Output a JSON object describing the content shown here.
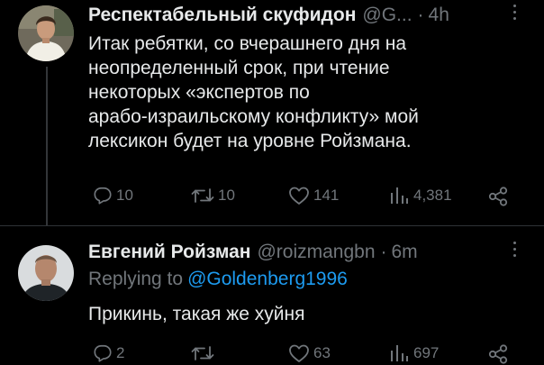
{
  "tweets": [
    {
      "author": {
        "display_name": "Респектабельный скуфидон",
        "handle": "@G...",
        "time": "4h"
      },
      "text_lines": [
        "Итак ребятки, со вчерашнего дня на",
        "неопределенный срок, при чтение",
        "некоторых «экспертов по",
        "арабо-израильскому конфликту» мой",
        "лексикон будет на уровне Ройзмана."
      ],
      "actions": {
        "replies": "10",
        "retweets": "10",
        "likes": "141",
        "views": "4,381"
      }
    },
    {
      "author": {
        "display_name": "Евгений Ройзман",
        "handle": "@roizmangbn",
        "time": "6m"
      },
      "replying_to_label": "Replying to",
      "replying_to_handle": "@Goldenberg1996",
      "text": "Прикинь, такая же хуйня",
      "actions": {
        "replies": "2",
        "retweets": "",
        "likes": "63",
        "views": "697"
      }
    }
  ],
  "separator": "·",
  "colors": {
    "background": "#000000",
    "text": "#e7e9ea",
    "muted": "#71767b",
    "link": "#1d9bf0",
    "divider": "#2f3336"
  }
}
